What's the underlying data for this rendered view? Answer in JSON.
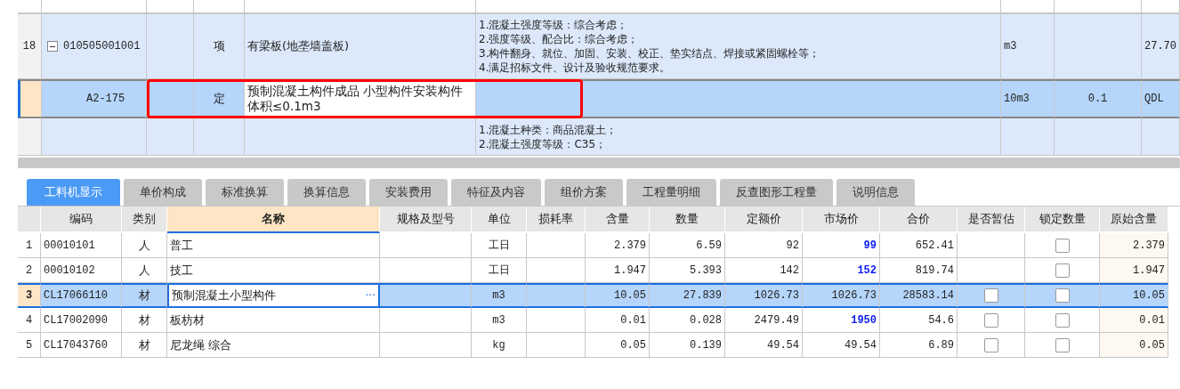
{
  "upper_table": {
    "rows": [
      {
        "number": "18",
        "code": "010505001001",
        "type": "项",
        "name": "有梁板(地垄墙盖板)",
        "description": [
          "1.混凝土强度等级：综合考虑；",
          "2.强度等级、配合比：综合考虑；",
          "3.构件翻身、就位、加固、安装、校正、垫实结点、焊接或紧固螺栓等；",
          "4.满足招标文件、设计及验收规范要求。"
        ],
        "unit": "m3",
        "column_9": "27.70",
        "expanded": true,
        "selected": false,
        "children": [
          {
            "code": "A2-175",
            "type": "定",
            "name": "预制混凝土构件成品 小型构件安装构件体积≤0.1m3",
            "unit": "10m3",
            "quantity": "0.1",
            "column_9": "QDL",
            "selected": true
          }
        ]
      },
      {
        "description": [
          "1.混凝土种类：商品混凝土；",
          "2.混凝土强度等级：C35；"
        ],
        "selected": false
      }
    ]
  },
  "tabs": [
    {
      "label": "工料机显示",
      "selected": true
    },
    {
      "label": "单价构成",
      "selected": false
    },
    {
      "label": "标准换算",
      "selected": false
    },
    {
      "label": "换算信息",
      "selected": false
    },
    {
      "label": "安装费用",
      "selected": false
    },
    {
      "label": "特征及内容",
      "selected": false
    },
    {
      "label": "组价方案",
      "selected": false
    },
    {
      "label": "工程量明细",
      "selected": false
    },
    {
      "label": "反查图形工程量",
      "selected": false
    },
    {
      "label": "说明信息",
      "selected": false
    }
  ],
  "resource_table": {
    "columns": [
      {
        "label": "编码",
        "selected": false
      },
      {
        "label": "类别",
        "selected": false
      },
      {
        "label": "名称",
        "selected": true
      },
      {
        "label": "规格及型号",
        "selected": false
      },
      {
        "label": "单位",
        "selected": false
      },
      {
        "label": "损耗率",
        "selected": false
      },
      {
        "label": "含量",
        "selected": false
      },
      {
        "label": "数量",
        "selected": false
      },
      {
        "label": "定额价",
        "selected": false
      },
      {
        "label": "市场价",
        "selected": false
      },
      {
        "label": "合价",
        "selected": false
      },
      {
        "label": "是否暂估",
        "selected": false
      },
      {
        "label": "锁定数量",
        "selected": false
      },
      {
        "label": "原始含量",
        "selected": false
      }
    ],
    "rows": [
      {
        "number": "1",
        "code": "00010101",
        "category": "人",
        "name": "普工",
        "unit": "工日",
        "content": "2.379",
        "quantity": "6.59",
        "quota_price": "92",
        "market_price": "99",
        "price_adjusted": true,
        "total": "652.41",
        "locked": false,
        "original_content": "2.379",
        "selected": false
      },
      {
        "number": "2",
        "code": "00010102",
        "category": "人",
        "name": "技工",
        "unit": "工日",
        "content": "1.947",
        "quantity": "5.393",
        "quota_price": "142",
        "market_price": "152",
        "price_adjusted": true,
        "total": "819.74",
        "locked": false,
        "original_content": "1.947",
        "selected": false
      },
      {
        "number": "3",
        "code": "CL17066110",
        "category": "材",
        "name": "预制混凝土小型构件",
        "name_button": "···",
        "unit": "m3",
        "content": "10.05",
        "quantity": "27.839",
        "quota_price": "1026.73",
        "market_price": "1026.73",
        "price_adjusted": false,
        "total": "28583.14",
        "estimated": false,
        "locked": false,
        "original_content": "10.05",
        "selected": true
      },
      {
        "number": "4",
        "code": "CL17002090",
        "category": "材",
        "name": "板枋材",
        "unit": "m3",
        "content": "0.01",
        "quantity": "0.028",
        "quota_price": "2479.49",
        "market_price": "1950",
        "price_adjusted": true,
        "total": "54.6",
        "estimated": false,
        "locked": false,
        "original_content": "0.01",
        "selected": false
      },
      {
        "number": "5",
        "code": "CL17043760",
        "category": "材",
        "name": "尼龙绳 综合",
        "unit": "kg",
        "content": "0.05",
        "quantity": "0.139",
        "quota_price": "49.54",
        "market_price": "49.54",
        "price_adjusted": false,
        "total": "6.89",
        "estimated": false,
        "locked": false,
        "original_content": "0.05",
        "selected": false
      }
    ]
  }
}
